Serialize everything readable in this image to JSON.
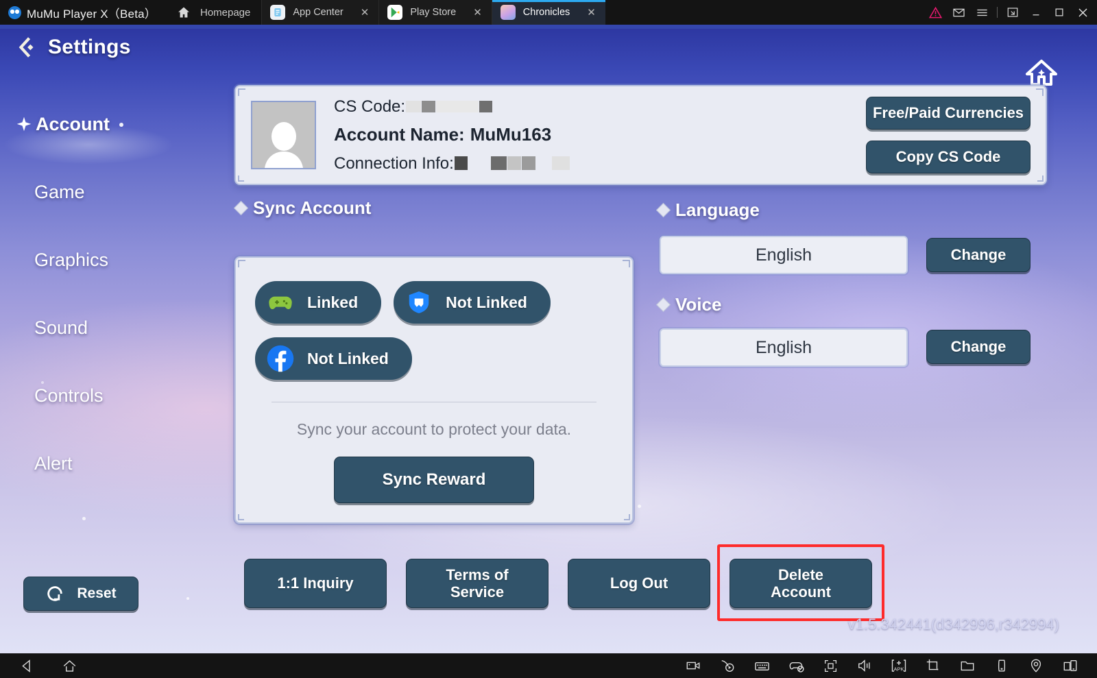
{
  "titlebar": {
    "app_name": "MuMu Player X（Beta）",
    "homepage_label": "Homepage",
    "tabs": [
      {
        "label": "App Center",
        "icon": "app-center-icon",
        "active": false
      },
      {
        "label": "Play Store",
        "icon": "play-store-icon",
        "active": false
      },
      {
        "label": "Chronicles",
        "icon": "chronicles-icon",
        "active": true
      }
    ],
    "close_glyph": "✕",
    "window_controls": [
      {
        "name": "warning-icon",
        "glyph": "warning"
      },
      {
        "name": "mail-icon",
        "glyph": "mail"
      },
      {
        "name": "menu-icon",
        "glyph": "menu"
      },
      {
        "name": "fullscreen-icon",
        "glyph": "fullscreen"
      },
      {
        "name": "minimize-icon",
        "glyph": "minimize"
      },
      {
        "name": "maximize-icon",
        "glyph": "maximize"
      },
      {
        "name": "close-icon",
        "glyph": "close"
      }
    ]
  },
  "game": {
    "header": {
      "title": "Settings",
      "back_icon": "back-arrow-icon",
      "home_icon": "home-icon"
    },
    "sidebar": {
      "items": [
        {
          "label": "Account",
          "active": true
        },
        {
          "label": "Game",
          "active": false
        },
        {
          "label": "Graphics",
          "active": false
        },
        {
          "label": "Sound",
          "active": false
        },
        {
          "label": "Controls",
          "active": false
        },
        {
          "label": "Alert",
          "active": false
        }
      ],
      "reset_label": "Reset",
      "reset_icon": "reset-icon"
    },
    "account_card": {
      "cs_code_label": "CS Code:",
      "cs_code_value": "",
      "account_name_label": "Account Name:",
      "account_name_value": "MuMu163",
      "connection_label": "Connection Info:",
      "connection_value": "",
      "free_paid_label": "Free/Paid Currencies",
      "copy_cs_label": "Copy CS Code"
    },
    "sync": {
      "section_label": "Sync Account",
      "links": [
        {
          "label": "Linked",
          "icon": "gamepad-icon"
        },
        {
          "label": "Not Linked",
          "icon": "shield-icon"
        },
        {
          "label": "Not Linked",
          "icon": "facebook-icon"
        }
      ],
      "note": "Sync your account to protect your data.",
      "reward_label": "Sync Reward"
    },
    "language": {
      "section_label": "Language",
      "value": "English",
      "change_label": "Change"
    },
    "voice": {
      "section_label": "Voice",
      "value": "English",
      "change_label": "Change"
    },
    "footer_buttons": [
      {
        "label": "1:1 Inquiry",
        "highlighted": false
      },
      {
        "label": "Terms of\nService",
        "line1": "Terms of",
        "line2": "Service",
        "highlighted": false
      },
      {
        "label": "Log Out",
        "highlighted": false
      },
      {
        "label": "Delete\nAccount",
        "line1": "Delete",
        "line2": "Account",
        "highlighted": true
      }
    ],
    "version": "v1.5.342441(d342996,r342994)"
  },
  "bottombar": {
    "left": [
      {
        "name": "back-nav-icon"
      },
      {
        "name": "home-nav-icon"
      }
    ],
    "right": [
      {
        "name": "record-video-icon"
      },
      {
        "name": "macro-record-icon"
      },
      {
        "name": "keyboard-icon"
      },
      {
        "name": "gamepad-disabled-icon"
      },
      {
        "name": "fullscreen-icon"
      },
      {
        "name": "volume-icon"
      },
      {
        "name": "install-apk-icon"
      },
      {
        "name": "screenshot-crop-icon"
      },
      {
        "name": "folder-icon"
      },
      {
        "name": "rotate-screen-icon"
      },
      {
        "name": "location-icon"
      },
      {
        "name": "multi-instance-icon"
      }
    ]
  },
  "colors": {
    "accent_button": "#31536a",
    "highlight_outline": "#fe2b2b",
    "tab_active_underline": "#2da9f0",
    "blue_rule": "#3446ad"
  }
}
